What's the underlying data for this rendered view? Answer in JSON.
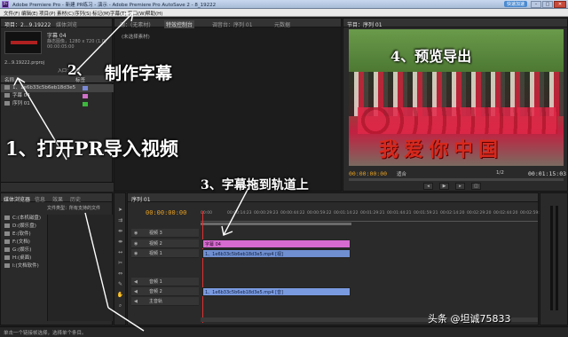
{
  "window": {
    "title": "Adobe Premiere Pro - 新建 PR练习 - 演示 - Adobe Premiere Pro AutoSave 2 - 8_19222",
    "badge": "快速加速",
    "icon": "premiere-app-icon"
  },
  "menu": [
    "文件(F)",
    "编辑(E)",
    "项目(P)",
    "素材(C)",
    "序列(S)",
    "标记(M)",
    "字幕(T)",
    "窗口(W)",
    "帮助(H)"
  ],
  "source_panel": {
    "tabs": [
      "源：(无素材)",
      "特效控制台",
      "调音台：序列 01",
      "元数据"
    ],
    "label": "(未选择素材)"
  },
  "project_panel": {
    "tabs": [
      "项目：2...9.19222",
      "媒体浏览"
    ],
    "clip_name": "字幕 04",
    "clip_info": "静态图像，1280 x 720 (1.0)",
    "clip_duration": "00:00:05:00",
    "project_file": "2...9.19222.prproj",
    "entry": "入口：全部",
    "columns": [
      "名称",
      "标签"
    ],
    "items": [
      {
        "name": "1、1e6b33c5b6eb18d3e5",
        "color": "#7a8ad8"
      },
      {
        "name": "字幕 04",
        "color": "#d070c8"
      },
      {
        "name": "序列 01",
        "color": "#3cb83c"
      }
    ]
  },
  "program_monitor": {
    "tab": "节目：序列 01",
    "timecode_left": "00:00:00:00",
    "timecode_right": "00:01:15:03",
    "fit": "适合",
    "ratio": "1/2",
    "overlay_title": "我爱你中国"
  },
  "media_browser": {
    "tabs": [
      "媒体浏览器",
      "信息",
      "效果",
      "历史"
    ],
    "filter_label": "文件类型：所有支持的文件",
    "drives": [
      "C:(本机磁盘)",
      "D:(娱乐盘)",
      "E:(软件)",
      "F:(文档)",
      "G:(娱乐)",
      "H:(桌面)",
      "I:(文档软件)"
    ]
  },
  "timeline": {
    "tab": "序列 01",
    "timecode": "00:00:00:00",
    "ruler": [
      "00:00",
      "00:00:14:23",
      "00:00:29:23",
      "00:00:44:22",
      "00:00:59:22",
      "00:01:14:22",
      "00:01:29:21",
      "00:01:44:21",
      "00:01:59:21",
      "00:02:14:20",
      "00:02:29:20",
      "00:02:44:20",
      "00:02:59:19"
    ],
    "tracks": [
      {
        "name": "视频 3"
      },
      {
        "name": "视频 2"
      },
      {
        "name": "视频 1"
      },
      {
        "name": "音频 1"
      },
      {
        "name": "音频 2"
      },
      {
        "name": "主音轨"
      }
    ],
    "clip_title": "字幕 04",
    "clip_video": "1、1e6b33c5b6eb18d3e5.mp4 [视]",
    "clip_audio": "1、1e6b33c5b6eb18d3e5.mp4 [音]"
  },
  "status_bar": "单击一个链接帧选择，选择单个条目。",
  "annotations": {
    "step1": "1、打开PR导入视频",
    "step2": "制作字幕",
    "step2_num": "2、",
    "step3": "3、字幕拖到轨道上",
    "step4": "4、预览导出"
  },
  "watermark": "头条 @坦诚75833",
  "colors": {
    "accent_timecode": "#e8a020",
    "title_clip": "#d66ad0",
    "video_clip": "#6f8fd0",
    "audio_clip": "#7a9ae0",
    "playhead": "#e03030"
  }
}
